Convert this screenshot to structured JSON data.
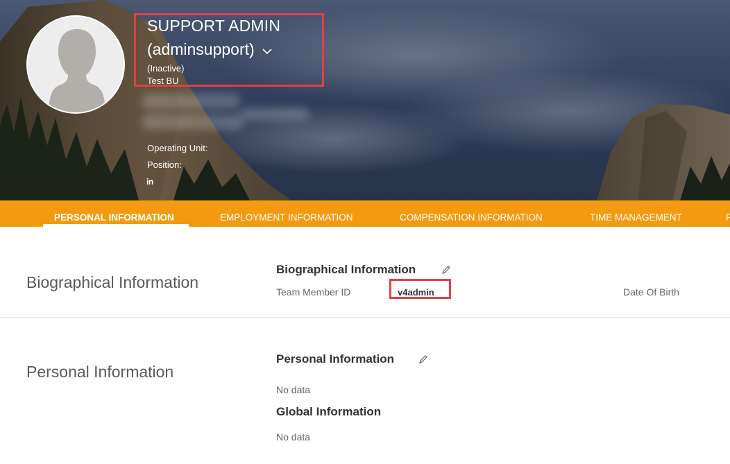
{
  "profile": {
    "display_name": "SUPPORT ADMIN",
    "username": "(adminsupport)",
    "status": "(Inactive)",
    "business_unit": "Test BU",
    "operating_unit_label": "Operating Unit:",
    "position_label": "Position:",
    "social_icon_text": "in"
  },
  "tabs": [
    {
      "label": "PERSONAL INFORMATION",
      "active": true
    },
    {
      "label": "EMPLOYMENT INFORMATION",
      "active": false
    },
    {
      "label": "COMPENSATION INFORMATION",
      "active": false
    },
    {
      "label": "TIME MANAGEMENT",
      "active": false
    },
    {
      "label": "P",
      "active": false
    }
  ],
  "sections": {
    "biographical": {
      "heading": "Biographical Information",
      "block_title": "Biographical Information",
      "team_member_id_label": "Team Member ID",
      "team_member_id_value": "v4admin",
      "date_of_birth_label": "Date Of Birth"
    },
    "personal": {
      "heading": "Personal Information",
      "block_title": "Personal Information",
      "personal_empty": "No data",
      "global_title": "Global Information",
      "global_empty": "No data"
    }
  },
  "colors": {
    "accent_orange": "#f39a10",
    "highlight_red": "#e53e48"
  },
  "icons": {
    "edit": "pencil-icon",
    "dropdown": "chevron-down-icon",
    "avatar": "user-silhouette-icon",
    "social": "linkedin-icon"
  }
}
